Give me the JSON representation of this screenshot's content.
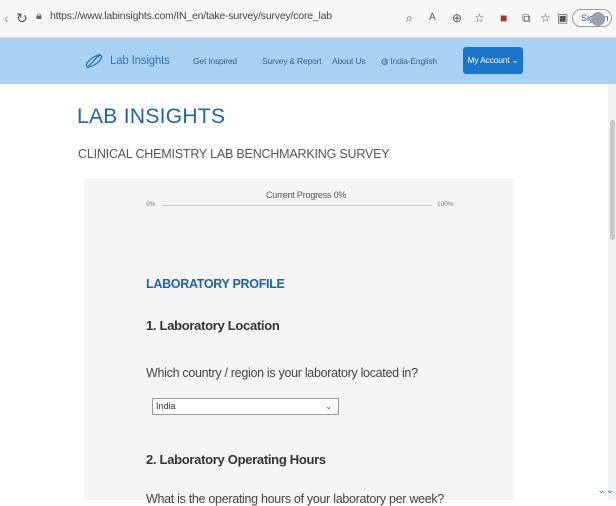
{
  "browser": {
    "url": "https://www.labinsights.com/IN_en/take-survey/survey/core_lab",
    "signin_label": "Sign in"
  },
  "site": {
    "logo_text": "Lab Insights",
    "nav": [
      "Get Inspired",
      "Survey & Report",
      "About Us",
      "India-English"
    ],
    "account_label": "My Account",
    "brand_title": "LAB INSIGHTS",
    "subtitle": "CLINICAL CHEMISTRY LAB BENCHMARKING SURVEY"
  },
  "progress": {
    "label": "Current Progress 0%",
    "min": "0%",
    "max": "100%",
    "value": 0
  },
  "survey": {
    "section_title": "LABORATORY PROFILE",
    "q1_title": "1. Laboratory Location",
    "q1_text": "Which country / region is your laboratory located in?",
    "q1_selected": "India",
    "q2_title": "2. Laboratory Operating Hours",
    "q2_text": "What is the operating hours of your laboratory per week?"
  },
  "colors": {
    "accent": "#1b75c9",
    "header_bg": "#a9d1f2",
    "title_blue": "#1f63a8"
  }
}
